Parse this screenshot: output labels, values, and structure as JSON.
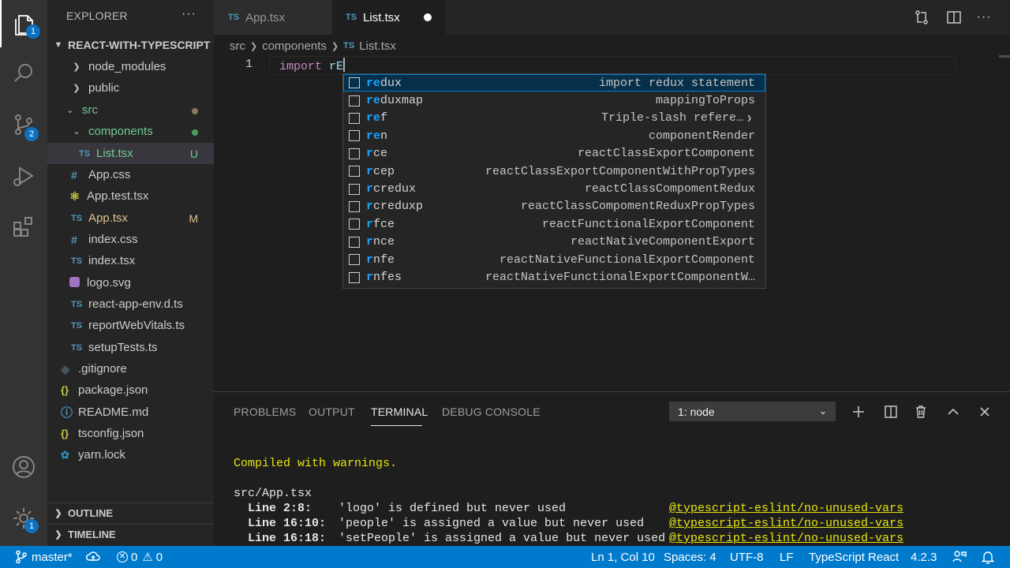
{
  "activity_bar": {
    "explorer_badge": "1",
    "scm_badge": "2",
    "settings_badge": "1"
  },
  "sidebar": {
    "title": "EXPLORER",
    "more": "···",
    "project": "REACT-WITH-TYPESCRIPT",
    "tree": [
      {
        "label": "node_modules",
        "type": "folder",
        "status": ""
      },
      {
        "label": "public",
        "type": "folder",
        "status": ""
      },
      {
        "label": "src",
        "type": "folder-open",
        "status": "dot"
      },
      {
        "label": "components",
        "type": "folder-open",
        "status": "dot"
      },
      {
        "label": "List.tsx",
        "type": "ts",
        "status": "U"
      },
      {
        "label": "App.css",
        "type": "css",
        "status": ""
      },
      {
        "label": "App.test.tsx",
        "type": "test",
        "status": ""
      },
      {
        "label": "App.tsx",
        "type": "ts",
        "status": "M"
      },
      {
        "label": "index.css",
        "type": "css",
        "status": ""
      },
      {
        "label": "index.tsx",
        "type": "ts",
        "status": ""
      },
      {
        "label": "logo.svg",
        "type": "svg",
        "status": ""
      },
      {
        "label": "react-app-env.d.ts",
        "type": "ts",
        "status": ""
      },
      {
        "label": "reportWebVitals.ts",
        "type": "ts",
        "status": ""
      },
      {
        "label": "setupTests.ts",
        "type": "ts",
        "status": ""
      },
      {
        "label": ".gitignore",
        "type": "git",
        "status": ""
      },
      {
        "label": "package.json",
        "type": "json",
        "status": ""
      },
      {
        "label": "README.md",
        "type": "info",
        "status": ""
      },
      {
        "label": "tsconfig.json",
        "type": "json",
        "status": ""
      },
      {
        "label": "yarn.lock",
        "type": "yarn",
        "status": ""
      }
    ],
    "icon_labels": {
      "ts": "TS",
      "css": "#",
      "json": "{}"
    },
    "outline": "OUTLINE",
    "timeline": "TIMELINE"
  },
  "tabs": [
    {
      "label": "App.tsx",
      "prefix": "TS",
      "active": false
    },
    {
      "label": "List.tsx",
      "prefix": "TS",
      "active": true,
      "modified": true
    }
  ],
  "breadcrumb": {
    "parts": [
      "src",
      "components"
    ],
    "file_prefix": "TS",
    "file": "List.tsx"
  },
  "editor": {
    "line_number": "1",
    "keyword": "import",
    "typed": "rE"
  },
  "suggest": [
    {
      "hl": "re",
      "rest": "dux",
      "detail": "import redux statement"
    },
    {
      "hl": "re",
      "rest": "duxmap",
      "detail": "mappingToProps"
    },
    {
      "hl": "re",
      "rest": "f",
      "detail": "Triple-slash refere…"
    },
    {
      "hl": "re",
      "rest": "n",
      "detail": "componentRender"
    },
    {
      "hl": "r",
      "rest": "ce",
      "detail": "reactClassExportComponent",
      "extra_hl": "e"
    },
    {
      "hl": "r",
      "rest": "cep",
      "detail": "reactClassExportComponentWithPropTypes"
    },
    {
      "hl": "r",
      "rest": "credux",
      "detail": "reactClassCompomentRedux"
    },
    {
      "hl": "r",
      "rest": "creduxp",
      "detail": "reactClassCompomentReduxPropTypes"
    },
    {
      "hl": "r",
      "rest": "fce",
      "detail": "reactFunctionalExportComponent"
    },
    {
      "hl": "r",
      "rest": "nce",
      "detail": "reactNativeComponentExport"
    },
    {
      "hl": "r",
      "rest": "nfe",
      "detail": "reactNativeFunctionalExportComponent"
    },
    {
      "hl": "r",
      "rest": "nfes",
      "detail": "reactNativeFunctionalExportComponentW…"
    }
  ],
  "panel": {
    "tabs": [
      "PROBLEMS",
      "OUTPUT",
      "TERMINAL",
      "DEBUG CONSOLE"
    ],
    "active_tab": "TERMINAL",
    "terminal_select": "1: node",
    "terminal": {
      "compiled": "Compiled with warnings.",
      "file": "src/App.tsx",
      "warnings": [
        {
          "line": "Line 2:8:",
          "msg": "'logo' is defined but never used",
          "rule": "@typescript-eslint/no-unused-vars"
        },
        {
          "line": "Line 16:10:",
          "msg": "'people' is assigned a value but never used",
          "rule": "@typescript-eslint/no-unused-vars"
        },
        {
          "line": "Line 16:18:",
          "msg": "'setPeople' is assigned a value but never used",
          "rule": "@typescript-eslint/no-unused-vars"
        }
      ]
    }
  },
  "status": {
    "branch": "master*",
    "errors": "0",
    "warnings": "0",
    "position": "Ln 1, Col 10",
    "spaces": "Spaces: 4",
    "encoding": "UTF-8",
    "eol": "LF",
    "language": "TypeScript React",
    "version": "4.2.3"
  },
  "colors": {
    "accent": "#007acc",
    "git_untracked": "#73c991",
    "git_modified": "#e2c08d",
    "suggest_highlight": "#18a3ff",
    "terminal_yellow": "#e5e510"
  }
}
